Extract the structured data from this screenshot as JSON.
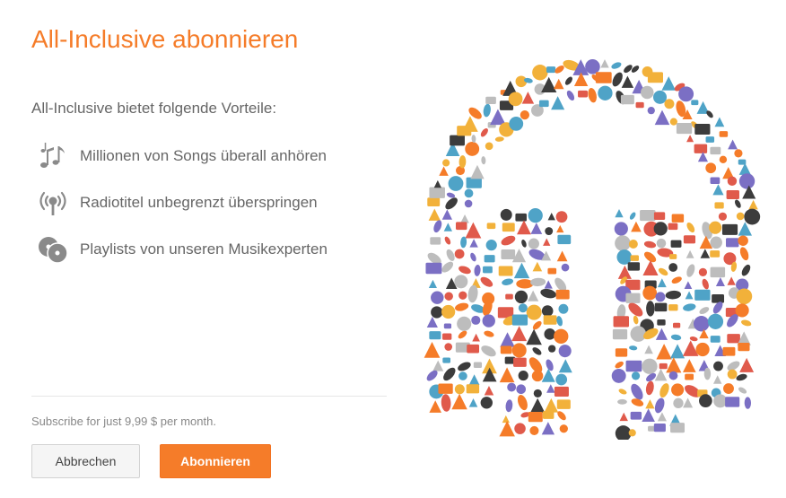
{
  "dialog": {
    "title": "All-Inclusive abonnieren",
    "intro": "All-Inclusive bietet folgende Vorteile:",
    "benefits": [
      {
        "icon": "music-notes-icon",
        "label": "Millionen von Songs überall anhören"
      },
      {
        "icon": "radio-broadcast-icon",
        "label": "Radiotitel unbegrenzt überspringen"
      },
      {
        "icon": "vinyl-records-icon",
        "label": "Playlists von unseren Musikexperten"
      }
    ],
    "subscribe_text": "Subscribe for just 9,99 $ per month.",
    "buttons": {
      "cancel": "Abbrechen",
      "subscribe": "Abonnieren"
    }
  },
  "illustration": {
    "icon": "headphones-illustration"
  },
  "colors": {
    "accent": "#f57c29",
    "icon_gray": "#8a8a8a",
    "illustration_palette": [
      "#f57c29",
      "#4fa3c7",
      "#e05a4b",
      "#7b6fc4",
      "#3c3c3c",
      "#f2b13a",
      "#bdbdbd"
    ]
  }
}
